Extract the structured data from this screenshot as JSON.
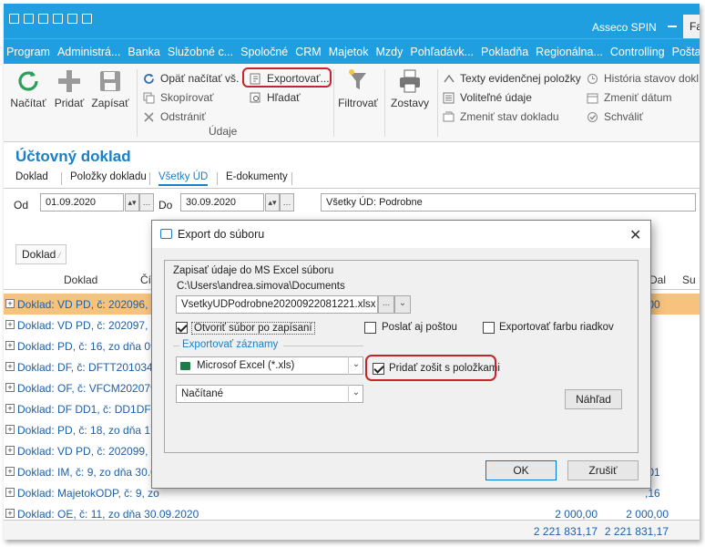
{
  "app": {
    "name": "Asseco SPIN",
    "tab_cut": "Fa"
  },
  "menu": [
    "Program",
    "Administrá...",
    "Banka",
    "Služobné c...",
    "Spoločné",
    "CRM",
    "Majetok",
    "Mzdy",
    "Pohľadávk...",
    "Pokladňa",
    "Regionálna...",
    "Controlling",
    "Pošta"
  ],
  "ribbon": {
    "load": "Načítať",
    "add": "Pridať",
    "save": "Zapísať",
    "reload": "Opäť načítať vš.",
    "copy": "Skopírovať",
    "remove": "Odstrániť",
    "export": "Exportovať...",
    "find": "Hľadať",
    "group_label": "Údaje",
    "filter": "Filtrovať",
    "reports": "Zostavy",
    "texts": "Texty evidenčnej položky",
    "optional": "Voliteľné údaje",
    "change_state": "Zmeniť stav dokladu",
    "history": "História stavov dokl",
    "change_date": "Zmeniť dátum",
    "approve": "Schváliť"
  },
  "document": {
    "title": "Účtovný doklad",
    "tabs": [
      "Doklad",
      "Položky dokladu",
      "Všetky ÚD",
      "E-dokumenty"
    ],
    "active_tab": 2
  },
  "filter": {
    "from_label": "Od",
    "from_value": "01.09.2020",
    "to_label": "Do",
    "to_value": "30.09.2020",
    "view_value": "Všetky ÚD: Podrobne"
  },
  "grid": {
    "group_chip": "Doklad",
    "headers": {
      "doklad": "Doklad",
      "cis": "Čís",
      "dal": "Dal",
      "su": "Su"
    },
    "rows": [
      {
        "label": "Doklad: VD PD, č: 202096, zo",
        "v2": ",00",
        "selected": true
      },
      {
        "label": "Doklad: VD PD, č: 202097, zo",
        "v2": ""
      },
      {
        "label": "Doklad: PD, č: 16, zo dňa 09.",
        "v2": ""
      },
      {
        "label": "Doklad: DF, č: DFTT201034,",
        "v2": ""
      },
      {
        "label": "Doklad: OF, č: VFCM202079",
        "v2": ""
      },
      {
        "label": "Doklad: DF DD1, č: DD1DF0",
        "v2": ""
      },
      {
        "label": "Doklad: PD, č: 18, zo dňa 17.",
        "v2": ""
      },
      {
        "label": "Doklad: VD PD, č: 202099, zo",
        "v2": ""
      },
      {
        "label": "Doklad: IM, č: 9, zo dňa 30.09",
        "v2": ",01"
      },
      {
        "label": "Doklad: MajetokODP, č: 9, zo",
        "v2": ",16"
      },
      {
        "label": "Doklad: OE, č: 11, zo dňa 30.09.2020",
        "v1": "2 000,00",
        "v2": "2 000,00"
      }
    ],
    "totals": {
      "v1": "2 221 831,17",
      "v2": "2 221 831,17"
    }
  },
  "dialog": {
    "title": "Export do súboru",
    "heading": "Zapisať údaje do MS Excel súboru",
    "path": "C:\\Users\\andrea.simova\\Documents",
    "filename": "VsetkyUDPodrobne20200922081221.xlsx",
    "browse": "...",
    "open_after": "Otvoriť súbor po zapísaní",
    "send_mail": "Poslať aj poštou",
    "export_color": "Exportovať farbu riadkov",
    "section": "Exportovať záznamy",
    "format": "Microsof Excel (*.xls)",
    "add_sheet": "Pridať zošit s položkami",
    "records": "Načítané",
    "preview": "Náhľad",
    "ok": "OK",
    "cancel": "Zrušiť"
  }
}
